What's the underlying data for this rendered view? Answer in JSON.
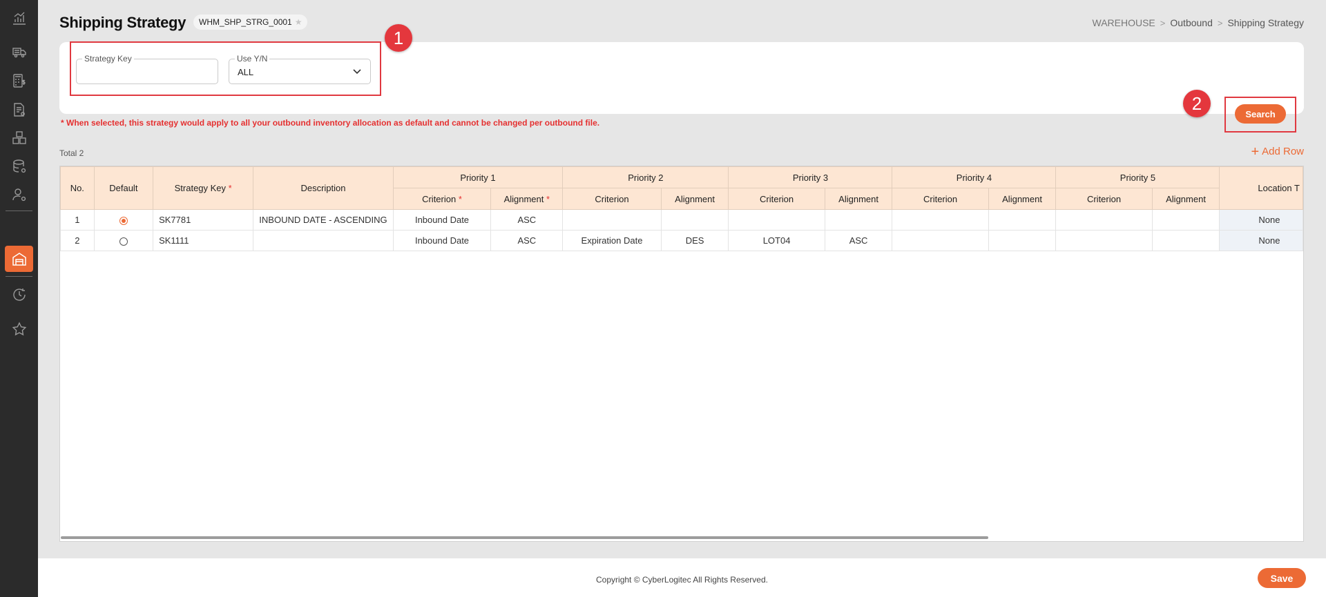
{
  "sidebar": {
    "items": [
      {
        "icon": "analytics-chart-icon"
      },
      {
        "icon": "truck-delivery-icon"
      },
      {
        "icon": "billing-calculator-icon"
      },
      {
        "icon": "document-settings-icon"
      },
      {
        "icon": "boxes-icon"
      },
      {
        "icon": "database-settings-icon"
      },
      {
        "icon": "user-settings-icon"
      },
      {
        "icon": "warehouse-icon",
        "active": true
      },
      {
        "icon": "history-clock-icon"
      },
      {
        "icon": "star-icon"
      }
    ]
  },
  "header": {
    "title": "Shipping Strategy",
    "code": "WHM_SHP_STRG_0001",
    "breadcrumb": [
      "WAREHOUSE",
      "Outbound",
      "Shipping Strategy"
    ]
  },
  "search": {
    "strategy_key_label": "Strategy Key",
    "strategy_key_value": "",
    "use_yn_label": "Use Y/N",
    "use_yn_value": "ALL",
    "button_label": "Search"
  },
  "annotations": [
    "1",
    "2"
  ],
  "notice": "* When selected, this strategy would apply to all your outbound inventory allocation as default and cannot be changed per outbound file.",
  "grid": {
    "total_label": "Total 2",
    "add_row_label": "Add Row",
    "headers": {
      "no": "No.",
      "default": "Default",
      "strategy_key": "Strategy Key",
      "description": "Description",
      "priorities": [
        "Priority 1",
        "Priority 2",
        "Priority 3",
        "Priority 4",
        "Priority 5"
      ],
      "criterion": "Criterion",
      "alignment": "Alignment",
      "location": "Location T",
      "required_mark": "*"
    },
    "rows": [
      {
        "no": "1",
        "default": true,
        "strategy_key": "SK7781",
        "description": "INBOUND DATE - ASCENDING",
        "p1c": "Inbound Date",
        "p1a": "ASC",
        "p2c": "",
        "p2a": "",
        "p3c": "",
        "p3a": "",
        "p4c": "",
        "p4a": "",
        "p5c": "",
        "p5a": "",
        "location": "None"
      },
      {
        "no": "2",
        "default": false,
        "strategy_key": "SK1111",
        "description": "",
        "p1c": "Inbound Date",
        "p1a": "ASC",
        "p2c": "Expiration Date",
        "p2a": "DES",
        "p3c": "LOT04",
        "p3a": "ASC",
        "p4c": "",
        "p4a": "",
        "p5c": "",
        "p5a": "",
        "location": "None"
      }
    ]
  },
  "footer": {
    "copyright": "Copyright © CyberLogitec All Rights Reserved.",
    "save_label": "Save"
  },
  "colors": {
    "accent": "#ec6a35",
    "sidebar_bg": "#2b2b2b",
    "header_bg": "#fde6d3",
    "annotation_red": "#e0383f"
  }
}
